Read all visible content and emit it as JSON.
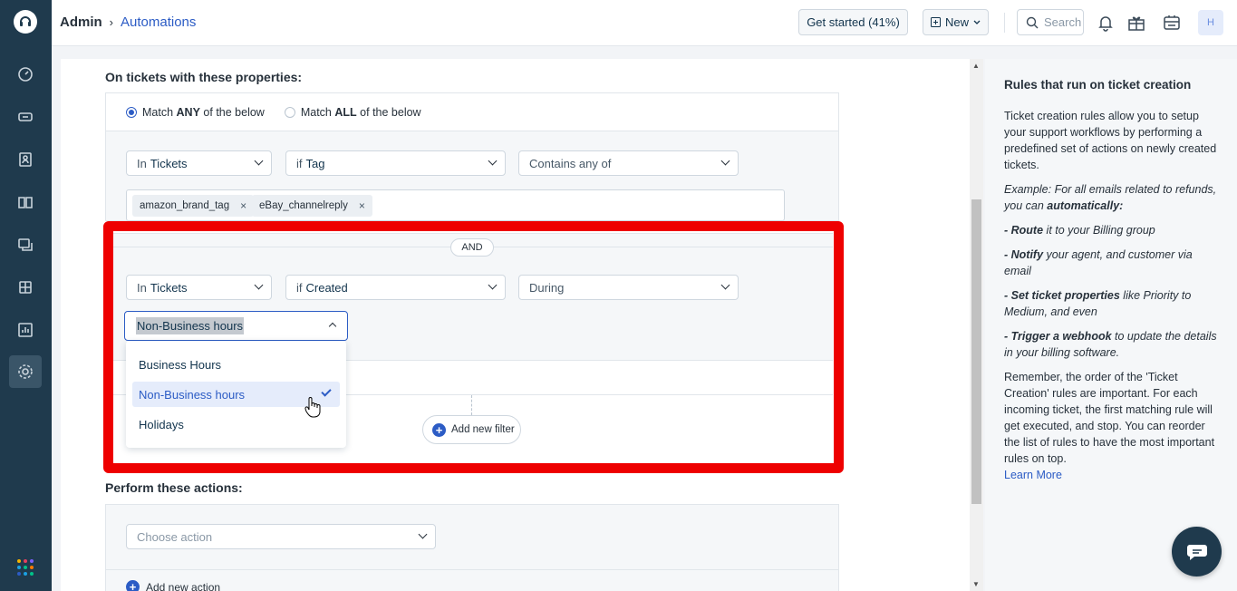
{
  "header": {
    "breadcrumb_root": "Admin",
    "breadcrumb_sep": "›",
    "breadcrumb_current": "Automations",
    "get_started": "Get started (41%)",
    "new_label": "New",
    "search_placeholder": "Search",
    "avatar": "H"
  },
  "conditions": {
    "title": "On tickets with these properties:",
    "match_any_prefix": "Match",
    "match_any_bold": "ANY",
    "match_any_suffix": "of the below",
    "match_all_prefix": "Match",
    "match_all_bold": "ALL",
    "match_all_suffix": "of the below",
    "row1": {
      "in_prefix": "In",
      "in_value": "Tickets",
      "if_prefix": "if",
      "if_value": "Tag",
      "operator": "Contains any of"
    },
    "tags": [
      "amazon_brand_tag",
      "eBay_channelreply"
    ],
    "tag_remove": "×",
    "and_label": "AND",
    "row2": {
      "in_prefix": "In",
      "in_value": "Tickets",
      "if_prefix": "if",
      "if_value": "Created",
      "operator": "During"
    },
    "value_select": "Non-Business hours",
    "options": [
      "Business Hours",
      "Non-Business hours",
      "Holidays"
    ],
    "add_filter": "Add new filter"
  },
  "actions": {
    "title": "Perform these actions:",
    "choose_placeholder": "Choose action",
    "add_action": "Add new action"
  },
  "help": {
    "title": "Rules that run on ticket creation",
    "intro": "Ticket creation rules allow you to setup your support workflows by performing a predefined set of actions on newly created tickets.",
    "example_prefix": "Example: For all emails related to refunds, you can ",
    "example_bold": "automatically:",
    "b1_bold": "- Route",
    "b1_rest": " it to your Billing group",
    "b2_bold": "- Notify",
    "b2_rest": " your agent, and customer via email",
    "b3_bold": "- Set ticket properties",
    "b3_rest": " like Priority to Medium, and even",
    "b4_bold": "- Trigger a webhook",
    "b4_rest": " to update the details in your billing software.",
    "remember": "Remember, the order of the 'Ticket Creation' rules are important. For each incoming ticket, the first matching rule will get executed, and stop. You can reorder the list of rules to have the most important rules on top.",
    "learn_more": "Learn More"
  },
  "colors": {
    "sidebar": "#1f3a4d",
    "accent": "#2c5cc5",
    "highlight": "#ee0000"
  }
}
